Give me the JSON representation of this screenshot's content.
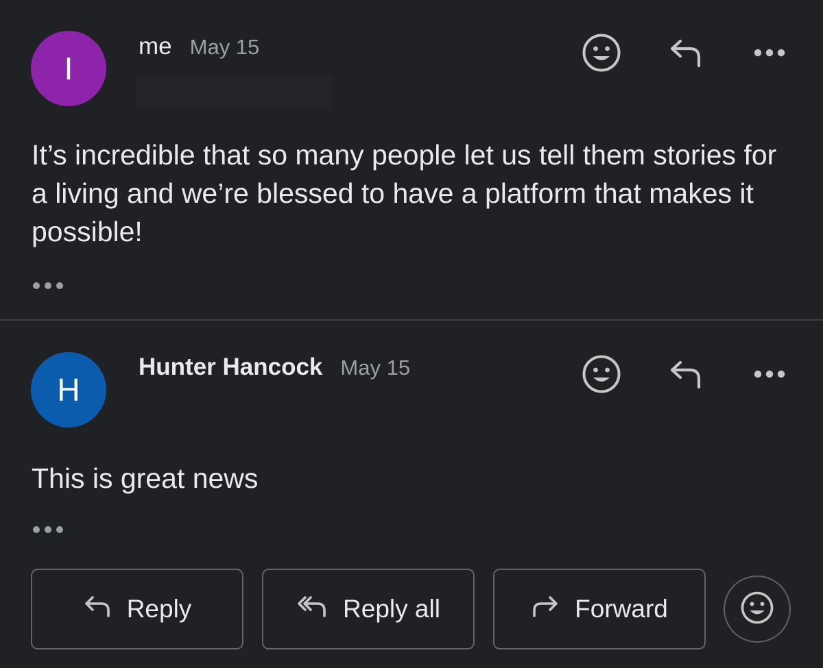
{
  "messages": [
    {
      "avatar_letter": "I",
      "avatar_color": "#8e24aa",
      "sender": "me",
      "date": "May 15",
      "body": "It’s incredible that so many people let us tell them stories for a living and we’re blessed to have a platform that makes it possible!"
    },
    {
      "avatar_letter": "H",
      "avatar_color": "#0b5cad",
      "sender": "Hunter Hancock",
      "date": "May 15",
      "body": "This is great news"
    }
  ],
  "actions": {
    "reply": "Reply",
    "reply_all": "Reply all",
    "forward": "Forward"
  },
  "icons": {
    "react": "smiley-icon",
    "reply": "reply-icon",
    "more": "more-icon",
    "reply_all": "reply-all-icon",
    "forward": "forward-icon",
    "trimmed": "ellipsis-icon"
  },
  "colors": {
    "background": "#202124",
    "text": "#e8eaed",
    "muted": "#9aa0a6",
    "border": "#5f6368"
  }
}
